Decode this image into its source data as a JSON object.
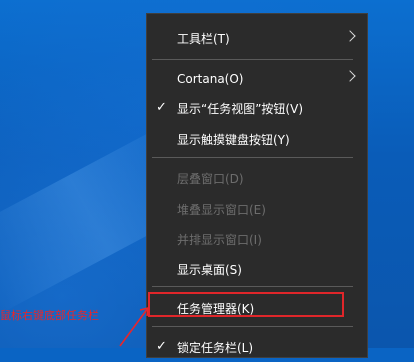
{
  "context_menu": {
    "items": [
      {
        "label": "工具栏(T)",
        "submenu": true
      },
      {
        "label": "Cortana(O)",
        "submenu": true
      },
      {
        "label": "显示“任务视图”按钮(V)",
        "checked": true
      },
      {
        "label": "显示触摸键盘按钮(Y)"
      },
      {
        "label": "层叠窗口(D)",
        "disabled": true
      },
      {
        "label": "堆叠显示窗口(E)",
        "disabled": true
      },
      {
        "label": "并排显示窗口(I)",
        "disabled": true
      },
      {
        "label": "显示桌面(S)"
      },
      {
        "label": "任务管理器(K)",
        "highlighted": true
      },
      {
        "label": "锁定任务栏(L)",
        "checked": true
      }
    ],
    "check_glyph": "✓"
  },
  "annotation": {
    "text": "鼠标右键底部任务栏",
    "color": "#e8262b"
  }
}
